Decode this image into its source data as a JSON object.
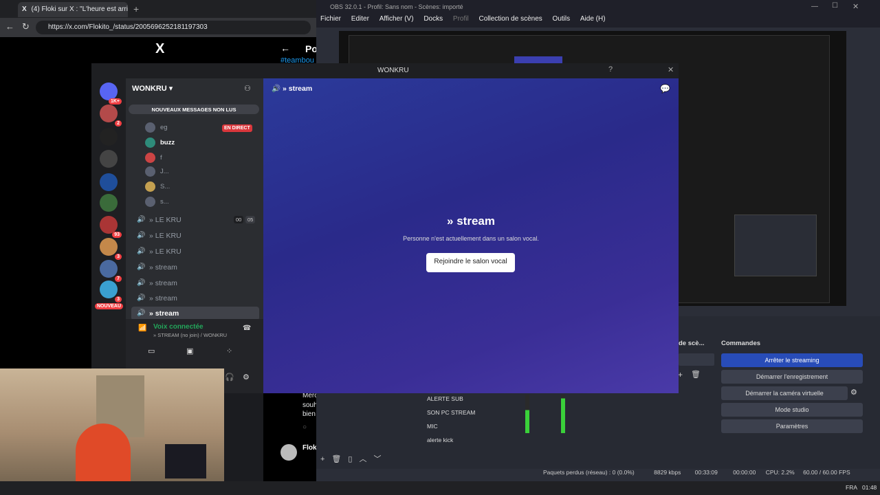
{
  "browser": {
    "tab_title": "(4) Floki sur X : \"L'heure est arrivée",
    "url": "https://x.com/Flokito_/status/2005696252181197303",
    "post_header": "Po",
    "hashtag": "#teambou",
    "tweet_text": [
      "Merc",
      "souh",
      "bien"
    ],
    "tweet_author": "Floki"
  },
  "obs": {
    "title": "OBS 32.0.1 - Profil: Sans nom - Scènes: importé",
    "menu": [
      "Fichier",
      "Editer",
      "Afficher (V)",
      "Docks",
      "Profil",
      "Collection de scènes",
      "Outils",
      "Aide (H)"
    ],
    "scenes_label": "de scè...",
    "commands_label": "Commandes",
    "commands": [
      "Arrêter le streaming",
      "Démarrer l'enregistrement",
      "Démarrer la caméra virtuelle",
      "Mode studio",
      "Paramètres"
    ],
    "sources": [
      "ALERTE SUB",
      "SON PC STREAM",
      "MIC",
      "alerte kick"
    ],
    "status": {
      "dropped": "Paquets perdus (réseau) : 0 (0.0%)",
      "bitrate": "8829 kbps",
      "stream_time": "00:33:09",
      "rec_time": "00:00:00",
      "cpu": "CPU: 2.2%",
      "fps": "60.00 / 60.00 FPS"
    }
  },
  "discord": {
    "window_title": "WONKRU",
    "server_name": "WONKRU",
    "new_messages": "NOUVEAUX MESSAGES NON LUS",
    "live_badge": "EN DIRECT",
    "users": [
      "eg",
      "buzz",
      "f",
      "J...",
      "S...",
      "s..."
    ],
    "channels": [
      "» LE KRU",
      "» LE KRU",
      "» LE KRU",
      "» stream",
      "» stream",
      "» stream",
      "» stream"
    ],
    "count_a": "00",
    "count_b": "05",
    "voice_connected": "Voix connectée",
    "voice_detail": "» STREAM (no join) / WONKRU",
    "header_channel": "» stream",
    "main_title": "» stream",
    "main_subtitle": "Personne n'est actuellement dans un salon vocal.",
    "join_button": "Rejoindre le salon vocal",
    "badges": [
      "1K+",
      "2",
      "93",
      "3",
      "7",
      "3",
      "NOUVEAU"
    ]
  },
  "taskbar": {
    "lang": "FRA",
    "clock": "01:48"
  }
}
